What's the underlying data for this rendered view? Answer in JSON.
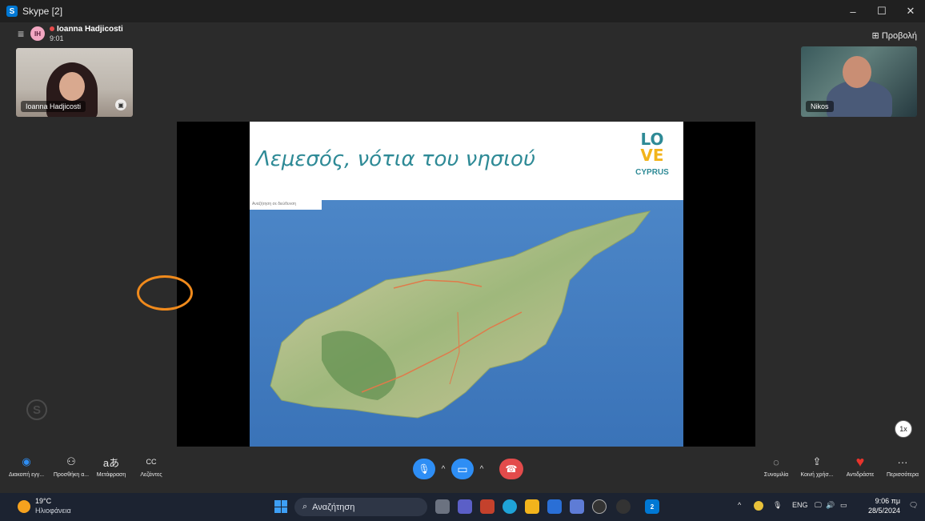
{
  "window": {
    "title": "Skype [2]",
    "logo_letter": "S",
    "controls": {
      "minimize": "–",
      "maximize": "☐",
      "close": "✕"
    }
  },
  "call": {
    "avatar_initials": "IH",
    "caller_name": "Ioanna Hadjicosti",
    "duration": "9:01",
    "view_button": "Προβολή",
    "view_icon_glyph": "⊞"
  },
  "participants": [
    {
      "name": "Ioanna Hadjicosti"
    },
    {
      "name": "Nikos"
    }
  ],
  "slide": {
    "title": "Λεμεσός, νότια του νησιού",
    "logo_line1": "LO",
    "logo_line2": "VE",
    "logo_word": "CYPRUS",
    "map_search_placeholder": "Αναζήτηση σε διεύθυνση"
  },
  "playback_speed": "1x",
  "controls": {
    "left": [
      {
        "label": "Διακοπή εγγ...",
        "icon": "record-icon",
        "glyph": "◉"
      },
      {
        "label": "Προσθήκη α...",
        "icon": "add-person-icon",
        "glyph": "⚇"
      },
      {
        "label": "Μετάφραση",
        "icon": "translate-icon",
        "glyph": "aあ"
      },
      {
        "label": "Λεζάντες",
        "icon": "captions-icon",
        "glyph": "CC"
      }
    ],
    "center": {
      "mic_glyph": "🎙",
      "video_glyph": "▭",
      "chevron_glyph": "^",
      "hangup_glyph": "☎"
    },
    "right": [
      {
        "label": "Συνομιλία",
        "icon": "chat-icon",
        "glyph": "◌"
      },
      {
        "label": "Κοινή χρήσ...",
        "icon": "share-icon",
        "glyph": "⇪"
      },
      {
        "label": "Αντιδράστε",
        "icon": "heart-icon",
        "glyph": "♥"
      },
      {
        "label": "Περισσότερα",
        "icon": "more-icon",
        "glyph": "···"
      }
    ]
  },
  "taskbar": {
    "weather_temp": "19°C",
    "weather_condition": "Ηλιοφάνεια",
    "search_placeholder": "Αναζήτηση",
    "search_glyph": "⌕",
    "tray_lang": "ENG",
    "clock_time": "9:06 πμ",
    "clock_date": "28/5/2024",
    "skype_badge": "2",
    "tray_glyphs": {
      "chevron": "^",
      "mic": "🎙",
      "network": "🖵",
      "sound": "🔊",
      "battery": "▭",
      "notifications": "🗨"
    }
  },
  "colors": {
    "accent": "#0078d4",
    "hangup": "#e34b4b",
    "slide_title": "#2e8a96",
    "highlight_circle": "#f08a1c"
  }
}
